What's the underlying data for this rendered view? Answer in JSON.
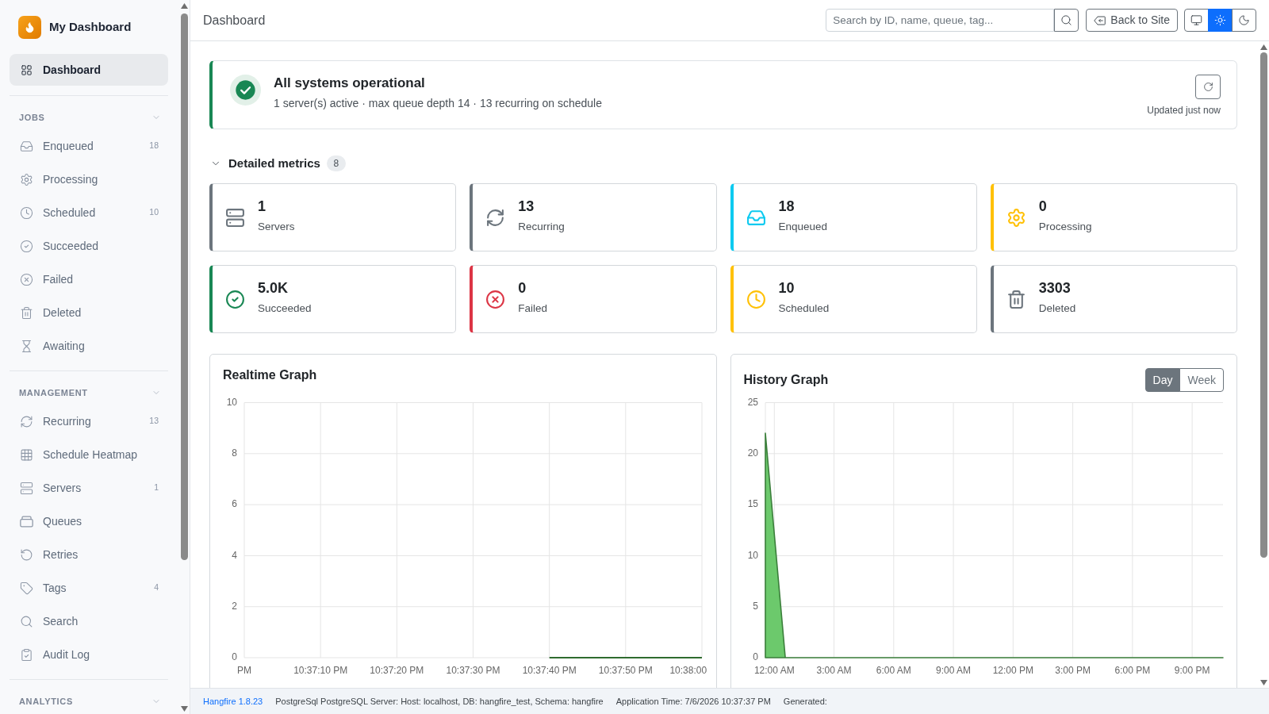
{
  "sidebar": {
    "brand": {
      "title": "My Dashboard"
    },
    "top_items": [
      {
        "label": "Dashboard",
        "selected": true
      }
    ],
    "sections": [
      {
        "title": "JOBS",
        "expanded": true,
        "items": [
          {
            "label": "Enqueued",
            "count": "18",
            "selected": false
          },
          {
            "label": "Processing",
            "selected": false
          },
          {
            "label": "Scheduled",
            "count": "10",
            "selected": false
          },
          {
            "label": "Succeeded",
            "selected": false
          },
          {
            "label": "Failed",
            "selected": false
          },
          {
            "label": "Deleted",
            "selected": false
          },
          {
            "label": "Awaiting",
            "selected": false
          }
        ]
      },
      {
        "title": "MANAGEMENT",
        "expanded": true,
        "items": [
          {
            "label": "Recurring",
            "count": "13",
            "selected": false
          },
          {
            "label": "Schedule Heatmap",
            "selected": false
          },
          {
            "label": "Servers",
            "count": "1",
            "selected": false
          },
          {
            "label": "Queues",
            "selected": false
          },
          {
            "label": "Retries",
            "selected": false
          },
          {
            "label": "Tags",
            "count": "4",
            "selected": false
          },
          {
            "label": "Search",
            "selected": false
          },
          {
            "label": "Audit Log",
            "selected": false
          }
        ]
      },
      {
        "title": "ANALYTICS",
        "expanded": true
      }
    ]
  },
  "header": {
    "title": "Dashboard",
    "search": {
      "placeholder": "Search by ID, name, queue, tag..."
    },
    "back_button": "Back to Site",
    "theme_buttons": [
      {
        "selected": false
      },
      {
        "selected": true
      },
      {
        "selected": false
      }
    ]
  },
  "status": {
    "kind": "ok",
    "title": "All systems operational",
    "summary": "1 server(s) active · max queue depth 14 · 13 recurring on schedule",
    "updated": "Updated just now"
  },
  "metrics": {
    "title": "Detailed metrics",
    "count": "8",
    "expanded": true,
    "cards": [
      {
        "value": "1",
        "label": "Servers",
        "color": "#6c757d"
      },
      {
        "value": "13",
        "label": "Recurring",
        "color": "#6c757d"
      },
      {
        "value": "18",
        "label": "Enqueued",
        "color": "#0dcaf0"
      },
      {
        "value": "0",
        "label": "Processing",
        "color": "#ffc107"
      },
      {
        "value": "5.0K",
        "label": "Succeeded",
        "color": "#198754"
      },
      {
        "value": "0",
        "label": "Failed",
        "color": "#dc3545"
      },
      {
        "value": "10",
        "label": "Scheduled",
        "color": "#ffc107"
      },
      {
        "value": "3303",
        "label": "Deleted",
        "color": "#6c757d"
      }
    ]
  },
  "charts": [
    {
      "title": "Realtime Graph",
      "chart_data": {
        "type": "line",
        "categories": [
          "PM",
          "10:37:10 PM",
          "10:37:20 PM",
          "10:37:30 PM",
          "10:37:40 PM",
          "10:37:50 PM",
          "10:38:00"
        ],
        "values": [
          null,
          null,
          null,
          null,
          0,
          0,
          0
        ],
        "color": "#2f6b2f",
        "ylim": [
          0,
          10
        ],
        "yticks": [
          0,
          2,
          4,
          6,
          8,
          10
        ],
        "grid": true
      }
    },
    {
      "title": "History Graph",
      "ranges": [
        {
          "label": "Day",
          "selected": true
        },
        {
          "label": "Week",
          "selected": false
        }
      ],
      "chart_data": {
        "type": "area",
        "x": [
          -0.45,
          0.55,
          1.55,
          2.55,
          3.55,
          4.55,
          5.55,
          6.55,
          7.55,
          8.55,
          9.55,
          10.55,
          11.55,
          12.55,
          13.55,
          14.55,
          15.55,
          16.55,
          17.55,
          18.55,
          19.55,
          20.55,
          21.55,
          22.55
        ],
        "values": [
          22,
          0,
          0,
          0,
          0,
          0,
          0,
          0,
          0,
          0,
          0,
          0,
          0,
          0,
          0,
          0,
          0,
          0,
          0,
          0,
          0,
          0,
          0,
          0
        ],
        "color": "#6cc96c",
        "xlim": [
          -0.45,
          22.55
        ],
        "ylim": [
          0,
          25
        ],
        "yticks": [
          0,
          5,
          10,
          15,
          20,
          25
        ],
        "xticks": [
          {
            "value": 0,
            "label": "12:00 AM"
          },
          {
            "value": 3,
            "label": "3:00 AM"
          },
          {
            "value": 6,
            "label": "6:00 AM"
          },
          {
            "value": 9,
            "label": "9:00 AM"
          },
          {
            "value": 12,
            "label": "12:00 PM"
          },
          {
            "value": 15,
            "label": "3:00 PM"
          },
          {
            "value": 18,
            "label": "6:00 PM"
          },
          {
            "value": 21,
            "label": "9:00 PM"
          }
        ],
        "grid": true
      }
    }
  ],
  "footer": {
    "version": "Hangfire 1.8.23",
    "storage": "PostgreSql PostgreSQL Server: Host: localhost, DB: hangfire_test, Schema: hangfire",
    "time": "Application Time: 7/6/2026 10:37:37 PM",
    "generated": "Generated:"
  }
}
